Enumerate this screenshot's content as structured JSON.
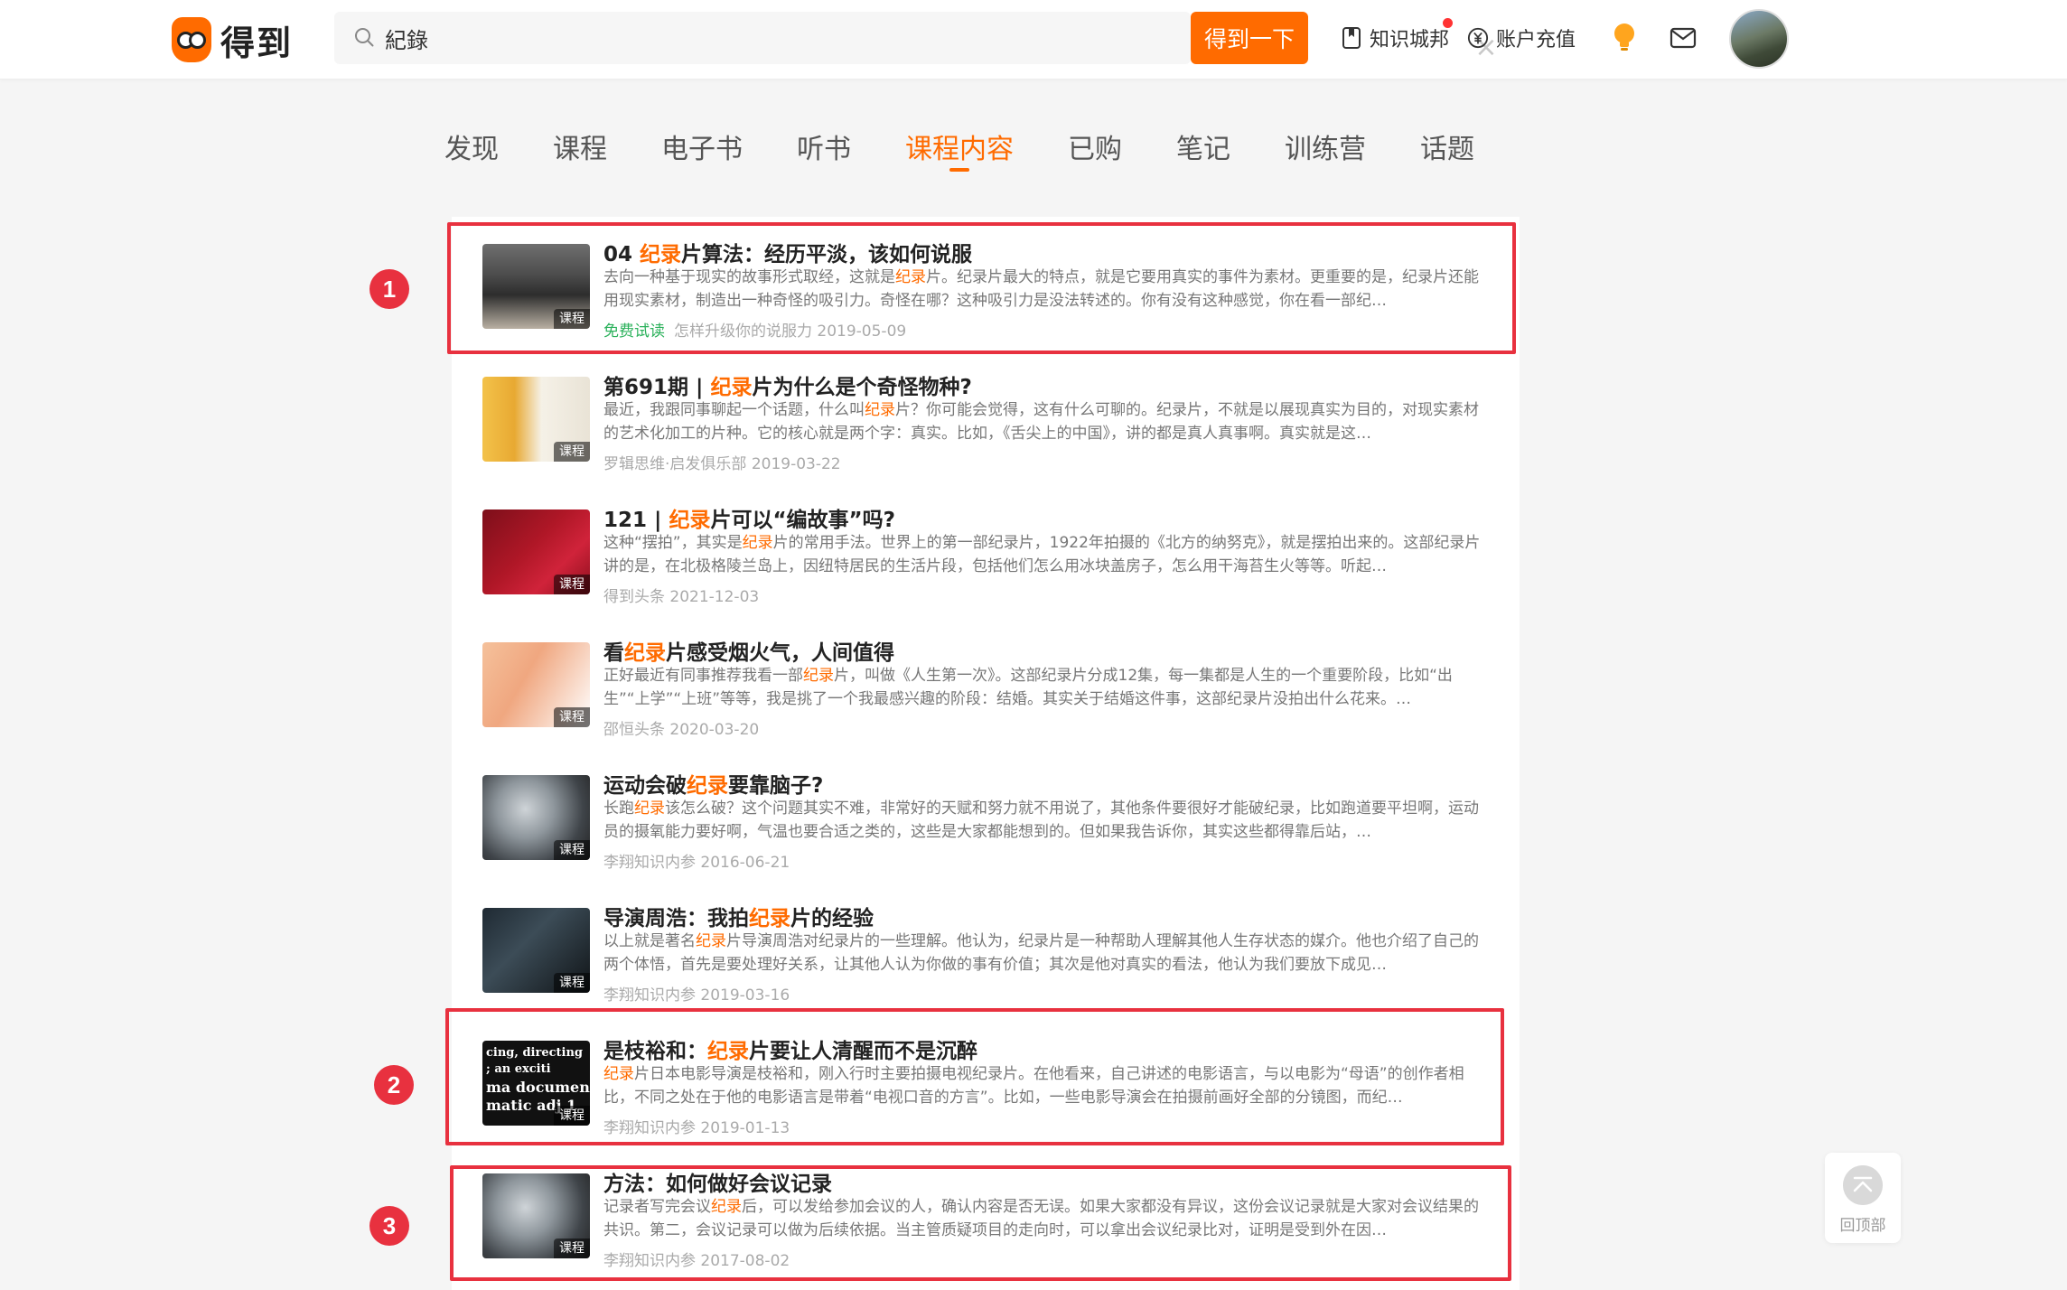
{
  "header": {
    "logo_text": "得到",
    "search_value": "紀錄",
    "search_button": "得到一下",
    "nav_community": "知识城邦",
    "nav_recharge": "账户充值"
  },
  "tabs": [
    {
      "label": "发现"
    },
    {
      "label": "课程"
    },
    {
      "label": "电子书"
    },
    {
      "label": "听书"
    },
    {
      "label": "课程内容",
      "active": true
    },
    {
      "label": "已购"
    },
    {
      "label": "笔记"
    },
    {
      "label": "训练营"
    },
    {
      "label": "话题"
    }
  ],
  "thumb_tag": "课程",
  "results": [
    {
      "title_pre": "04 ",
      "title_hl": "纪录",
      "title_post": "片算法：经历平淡，该如何说服",
      "desc_pre": "去向一种基于现实的故事形式取经，这就是",
      "desc_hl": "纪录",
      "desc_post": "片。纪录片最大的特点，就是它要用真实的事件为素材。更重要的是，纪录片还能用现实素材，制造出一种奇怪的吸引力。奇怪在哪？这种吸引力是没法转述的。你有没有这种感觉，你在看一部纪…",
      "free_label": "免费试读",
      "source": "怎样升级你的说服力",
      "date": "2019-05-09"
    },
    {
      "title_pre": "第691期 | ",
      "title_hl": "纪录",
      "title_post": "片为什么是个奇怪物种?",
      "desc_pre": "最近，我跟同事聊起一个话题，什么叫",
      "desc_hl": "纪录",
      "desc_post": "片？你可能会觉得，这有什么可聊的。纪录片，不就是以展现真实为目的，对现实素材的艺术化加工的片种。它的核心就是两个字：真实。比如，《舌尖上的中国》，讲的都是真人真事啊。真实就是这…",
      "source": "罗辑思维·启发俱乐部",
      "date": "2019-03-22"
    },
    {
      "title_pre": "121 | ",
      "title_hl": "纪录",
      "title_post": "片可以“编故事”吗?",
      "desc_pre": "这种“摆拍”，其实是",
      "desc_hl": "纪录",
      "desc_post": "片的常用手法。世界上的第一部纪录片，1922年拍摄的《北方的纳努克》，就是摆拍出来的。这部纪录片讲的是，在北极格陵兰岛上，因纽特居民的生活片段，包括他们怎么用冰块盖房子，怎么用干海苔生火等等。听起…",
      "source": "得到头条",
      "date": "2021-12-03"
    },
    {
      "title_pre": "看",
      "title_hl": "纪录",
      "title_post": "片感受烟火气，人间值得",
      "desc_pre": "正好最近有同事推荐我看一部",
      "desc_hl": "纪录",
      "desc_post": "片，叫做《人生第一次》。这部纪录片分成12集，每一集都是人生的一个重要阶段，比如“出生”“上学”“上班”等等，我是挑了一个我最感兴趣的阶段：结婚。其实关于结婚这件事，这部纪录片没拍出什么花来。…",
      "source": "邵恒头条",
      "date": "2020-03-20"
    },
    {
      "title_pre": "运动会破",
      "title_hl": "纪录",
      "title_post": "要靠脑子?",
      "desc_pre": "长跑",
      "desc_hl": "纪录",
      "desc_post": "该怎么破？这个问题其实不难，非常好的天赋和努力就不用说了，其他条件要很好才能破纪录，比如跑道要平坦啊，运动员的摄氧能力要好啊，气温也要合适之类的，这些是大家都能想到的。但如果我告诉你，其实这些都得靠后站，…",
      "source": "李翔知识内参",
      "date": "2016-06-21"
    },
    {
      "title_pre": "导演周浩：我拍",
      "title_hl": "纪录",
      "title_post": "片的经验",
      "desc_pre": "以上就是著名",
      "desc_hl": "纪录",
      "desc_post": "片导演周浩对纪录片的一些理解。他认为，纪录片是一种帮助人理解其他人生存状态的媒介。他也介绍了自己的两个体悟，首先是要处理好关系，让其他人认为你做的事有价值；其次是他对真实的看法，他认为我们要放下成见…",
      "source": "李翔知识内参",
      "date": "2019-03-16"
    },
    {
      "title_pre": "是枝裕和：",
      "title_hl": "纪录",
      "title_post": "片要让人清醒而不是沉醉",
      "desc_pre": "",
      "desc_hl": "纪录",
      "desc_post": "片日本电影导演是枝裕和，刚入行时主要拍摄电视纪录片。在他看来，自己讲述的电影语言，与以电影为“母语”的创作者相比，不同之处在于他的电影语言是带着“电视口音的方言”。比如，一些电影导演会在拍摄前画好全部的分镜图，而纪…",
      "source": "李翔知识内参",
      "date": "2019-01-13",
      "thumb_words": [
        "cing, directing",
        "; an exciti",
        "ma documen",
        "matic adj 1"
      ]
    },
    {
      "title_pre": "方法：如何做好会议记录",
      "title_hl": "",
      "title_post": "",
      "desc_pre": "记录者写完会议",
      "desc_hl": "纪录",
      "desc_post": "后，可以发给参加会议的人，确认内容是否无误。如果大家都没有异议，这份会议记录就是大家对会议结果的共识。第二，会议记录可以做为后续依据。当主管质疑项目的走向时，可以拿出会议纪录比对，证明是受到外在因…",
      "source": "李翔知识内参",
      "date": "2017-08-02"
    }
  ],
  "annotations": [
    "1",
    "2",
    "3"
  ],
  "back_to_top": "回顶部",
  "colors": {
    "brand": "#ff6b00",
    "annotation": "#e8313f",
    "free": "#2bb15b"
  }
}
